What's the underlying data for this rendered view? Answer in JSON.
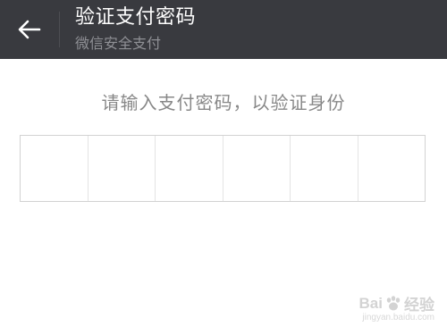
{
  "header": {
    "title": "验证支付密码",
    "subtitle": "微信安全支付",
    "back_icon": "arrow-left-icon"
  },
  "prompt": "请输入支付密码，以验证身份",
  "pin": {
    "length": 6,
    "entered": 0
  },
  "watermark": {
    "text_left": "Bai",
    "text_right": "经验",
    "url": "jingyan.baidu.com",
    "icon": "paw-icon"
  },
  "colors": {
    "header_bg": "#393a3f",
    "title": "#ffffff",
    "subtitle": "#8f9095",
    "prompt": "#888888",
    "box_border": "#d2d2d2"
  }
}
